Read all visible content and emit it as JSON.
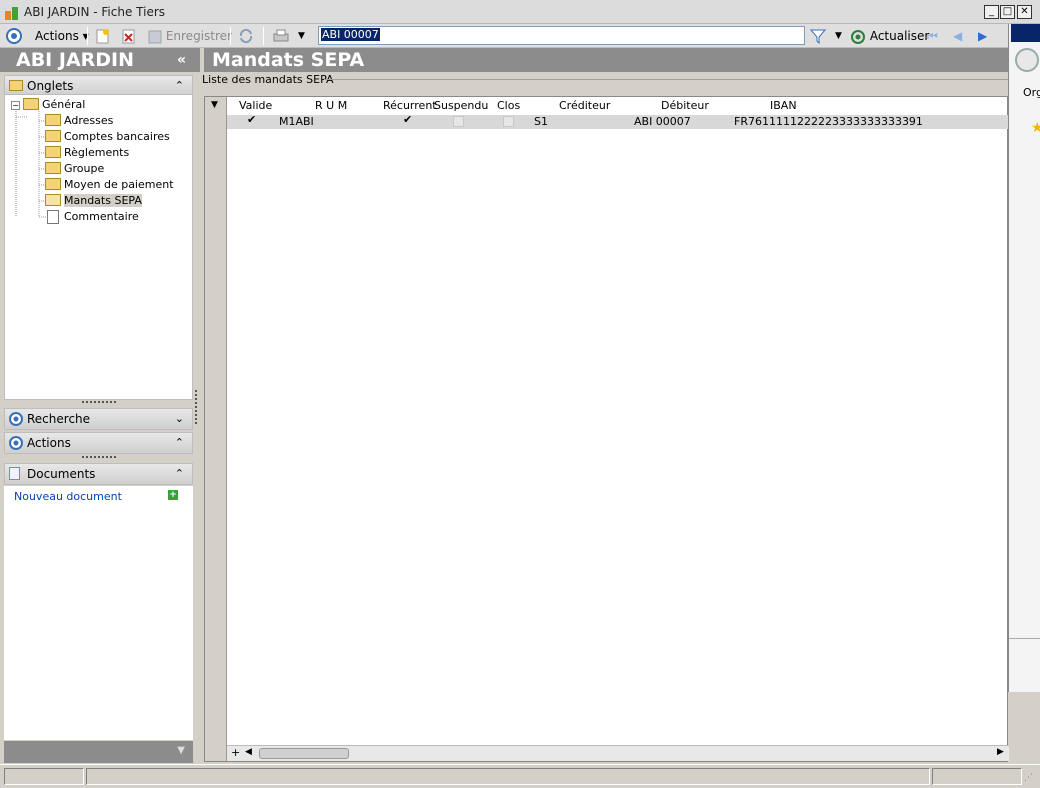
{
  "window": {
    "title": "ABI JARDIN - Fiche Tiers"
  },
  "toolbar": {
    "actions_label": "Actions",
    "save_label": "Enregistrer",
    "search_value": "ABI 00007",
    "refresh_label": "Actualiser"
  },
  "left": {
    "company": "ABI JARDIN",
    "collapse_glyph": "«",
    "tabs_header": "Onglets",
    "tree": [
      {
        "label": "Général"
      },
      {
        "label": "Adresses"
      },
      {
        "label": "Comptes bancaires"
      },
      {
        "label": "Règlements"
      },
      {
        "label": "Groupe"
      },
      {
        "label": "Moyen de paiement"
      },
      {
        "label": "Mandats SEPA"
      },
      {
        "label": "Commentaire"
      }
    ],
    "search_section": "Recherche",
    "actions_section": "Actions",
    "documents_section": "Documents",
    "new_document": "Nouveau document"
  },
  "main": {
    "title": "Mandats SEPA",
    "group_label": "Liste des mandats SEPA",
    "columns": [
      "Valide",
      "R U M",
      "Récurrent",
      "Suspendu",
      "Clos",
      "Créditeur",
      "Débiteur",
      "IBAN"
    ],
    "rows": [
      {
        "rum": "M1ABI",
        "creditor": "S1",
        "debtor": "ABI 00007",
        "iban": "FR7611111222223333333333391"
      }
    ]
  },
  "rightwin": {
    "partial_text": "Org"
  },
  "colors": {
    "header_gray": "#8c8c8c",
    "selection_blue": "#0a246a",
    "link_blue": "#0645ad"
  }
}
